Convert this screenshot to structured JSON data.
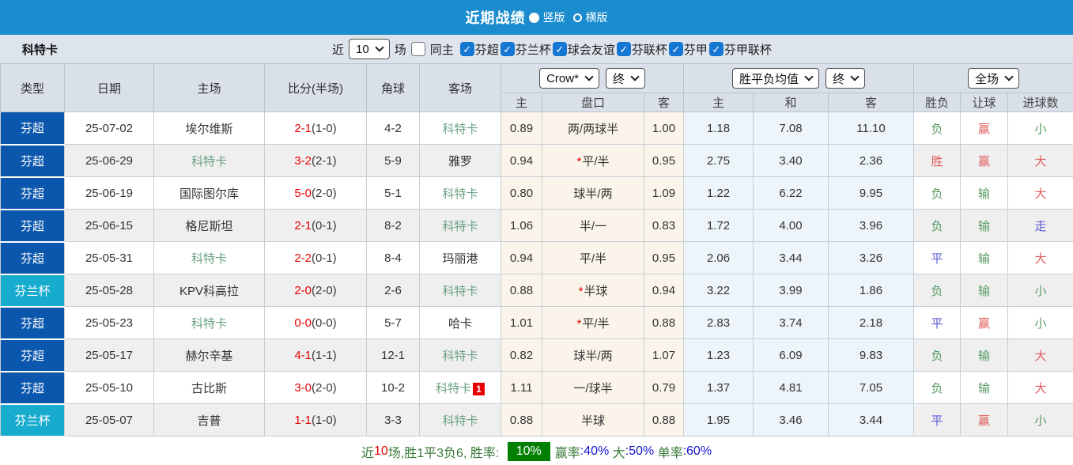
{
  "title_bar": {
    "title": "近期战绩",
    "radio_vertical": "竖版",
    "radio_horizontal": "横版"
  },
  "filter_bar": {
    "team": "科特卡",
    "near_label": "近",
    "matches_select": "10",
    "games_label": "场",
    "same_venue_label": "同主",
    "leagues": [
      "芬超",
      "芬兰杯",
      "球会友谊",
      "芬联杯",
      "芬甲",
      "芬甲联杯"
    ]
  },
  "header": {
    "col_type": "类型",
    "col_date": "日期",
    "col_home": "主场",
    "col_score": "比分(半场)",
    "col_corner": "角球",
    "col_away": "客场",
    "odds_selects": {
      "company": "Crow*",
      "stage": "终"
    },
    "avg_selects": {
      "label": "胜平负均值",
      "stage": "终"
    },
    "scope_select": "全场",
    "sub": [
      "主",
      "盘口",
      "客",
      "主",
      "和",
      "客",
      "胜负",
      "让球",
      "进球数"
    ]
  },
  "rows": [
    {
      "type": "芬超",
      "league": "super",
      "date": "25-07-02",
      "home": "埃尔维斯",
      "home_team": false,
      "score": "2-1",
      "half": "(1-0)",
      "corner": "4-2",
      "away": "科特卡",
      "away_team": true,
      "badge": "",
      "h": "0.89",
      "handicap": "两/两球半",
      "star": false,
      "a": "1.00",
      "avg_h": "1.18",
      "avg_d": "7.08",
      "avg_a": "11.10",
      "res": "负",
      "res_c": "green",
      "let": "赢",
      "let_c": "red",
      "goal": "小",
      "goal_c": "green"
    },
    {
      "type": "芬超",
      "league": "super",
      "date": "25-06-29",
      "home": "科特卡",
      "home_team": true,
      "score": "3-2",
      "half": "(2-1)",
      "corner": "5-9",
      "away": "雅罗",
      "away_team": false,
      "badge": "",
      "h": "0.94",
      "handicap": "平/半",
      "star": true,
      "a": "0.95",
      "avg_h": "2.75",
      "avg_d": "3.40",
      "avg_a": "2.36",
      "res": "胜",
      "res_c": "red",
      "let": "赢",
      "let_c": "red",
      "goal": "大",
      "goal_c": "red"
    },
    {
      "type": "芬超",
      "league": "super",
      "date": "25-06-19",
      "home": "国际图尔库",
      "home_team": false,
      "score": "5-0",
      "half": "(2-0)",
      "corner": "5-1",
      "away": "科特卡",
      "away_team": true,
      "badge": "",
      "h": "0.80",
      "handicap": "球半/两",
      "star": false,
      "a": "1.09",
      "avg_h": "1.22",
      "avg_d": "6.22",
      "avg_a": "9.95",
      "res": "负",
      "res_c": "green",
      "let": "输",
      "let_c": "green",
      "goal": "大",
      "goal_c": "red"
    },
    {
      "type": "芬超",
      "league": "super",
      "date": "25-06-15",
      "home": "格尼斯坦",
      "home_team": false,
      "score": "2-1",
      "half": "(0-1)",
      "corner": "8-2",
      "away": "科特卡",
      "away_team": true,
      "badge": "",
      "h": "1.06",
      "handicap": "半/一",
      "star": false,
      "a": "0.83",
      "avg_h": "1.72",
      "avg_d": "4.00",
      "avg_a": "3.96",
      "res": "负",
      "res_c": "green",
      "let": "输",
      "let_c": "green",
      "goal": "走",
      "goal_c": "blue"
    },
    {
      "type": "芬超",
      "league": "super",
      "date": "25-05-31",
      "home": "科特卡",
      "home_team": true,
      "score": "2-2",
      "half": "(0-1)",
      "corner": "8-4",
      "away": "玛丽港",
      "away_team": false,
      "badge": "",
      "h": "0.94",
      "handicap": "平/半",
      "star": false,
      "a": "0.95",
      "avg_h": "2.06",
      "avg_d": "3.44",
      "avg_a": "3.26",
      "res": "平",
      "res_c": "blue",
      "let": "输",
      "let_c": "green",
      "goal": "大",
      "goal_c": "red"
    },
    {
      "type": "芬兰杯",
      "league": "cup",
      "date": "25-05-28",
      "home": "KPV科高拉",
      "home_team": false,
      "score": "2-0",
      "half": "(2-0)",
      "corner": "2-6",
      "away": "科特卡",
      "away_team": true,
      "badge": "",
      "h": "0.88",
      "handicap": "半球",
      "star": true,
      "a": "0.94",
      "avg_h": "3.22",
      "avg_d": "3.99",
      "avg_a": "1.86",
      "res": "负",
      "res_c": "green",
      "let": "输",
      "let_c": "green",
      "goal": "小",
      "goal_c": "green"
    },
    {
      "type": "芬超",
      "league": "super",
      "date": "25-05-23",
      "home": "科特卡",
      "home_team": true,
      "score": "0-0",
      "half": "(0-0)",
      "corner": "5-7",
      "away": "哈卡",
      "away_team": false,
      "badge": "",
      "h": "1.01",
      "handicap": "平/半",
      "star": true,
      "a": "0.88",
      "avg_h": "2.83",
      "avg_d": "3.74",
      "avg_a": "2.18",
      "res": "平",
      "res_c": "blue",
      "let": "赢",
      "let_c": "red",
      "goal": "小",
      "goal_c": "green"
    },
    {
      "type": "芬超",
      "league": "super",
      "date": "25-05-17",
      "home": "赫尔辛基",
      "home_team": false,
      "score": "4-1",
      "half": "(1-1)",
      "corner": "12-1",
      "away": "科特卡",
      "away_team": true,
      "badge": "",
      "h": "0.82",
      "handicap": "球半/两",
      "star": false,
      "a": "1.07",
      "avg_h": "1.23",
      "avg_d": "6.09",
      "avg_a": "9.83",
      "res": "负",
      "res_c": "green",
      "let": "输",
      "let_c": "green",
      "goal": "大",
      "goal_c": "red"
    },
    {
      "type": "芬超",
      "league": "super",
      "date": "25-05-10",
      "home": "古比斯",
      "home_team": false,
      "score": "3-0",
      "half": "(2-0)",
      "corner": "10-2",
      "away": "科特卡",
      "away_team": true,
      "badge": "1",
      "h": "1.11",
      "handicap": "一/球半",
      "star": false,
      "a": "0.79",
      "avg_h": "1.37",
      "avg_d": "4.81",
      "avg_a": "7.05",
      "res": "负",
      "res_c": "green",
      "let": "输",
      "let_c": "green",
      "goal": "大",
      "goal_c": "red"
    },
    {
      "type": "芬兰杯",
      "league": "cup",
      "date": "25-05-07",
      "home": "吉普",
      "home_team": false,
      "score": "1-1",
      "half": "(1-0)",
      "corner": "3-3",
      "away": "科特卡",
      "away_team": true,
      "badge": "",
      "h": "0.88",
      "handicap": "半球",
      "star": false,
      "a": "0.88",
      "avg_h": "1.95",
      "avg_d": "3.46",
      "avg_a": "3.44",
      "res": "平",
      "res_c": "blue",
      "let": "赢",
      "let_c": "red",
      "goal": "小",
      "goal_c": "green"
    }
  ],
  "summary": {
    "segments": [
      {
        "t": "近",
        "c": "green"
      },
      {
        "t": "10",
        "c": "red"
      },
      {
        "t": "场,胜1平3负6, 胜率: ",
        "c": "green"
      },
      {
        "t": "10%",
        "c": "badge-green"
      },
      {
        "t": "赢率",
        "c": "green"
      },
      {
        "t": ":40%",
        "c": "blue"
      },
      {
        "t": " 大",
        "c": "green"
      },
      {
        "t": ":50%",
        "c": "blue"
      },
      {
        "t": " 单率",
        "c": "green"
      },
      {
        "t": ":60%",
        "c": "blue"
      }
    ]
  },
  "colors": {
    "accent_bar": "#1b8cce",
    "league_super": "#0b57ad",
    "league_cup": "#17abce",
    "score_red": "#e60000",
    "team_green": "#6ba283",
    "pos_red": "#e05c5c",
    "neu_blue": "#5a5ad6",
    "neg_green": "#569a63",
    "summary_green": "#3a7a3a",
    "summary_blue": "#1414cc",
    "badge_green": "#018001",
    "checkbox_blue": "#1677d2"
  }
}
